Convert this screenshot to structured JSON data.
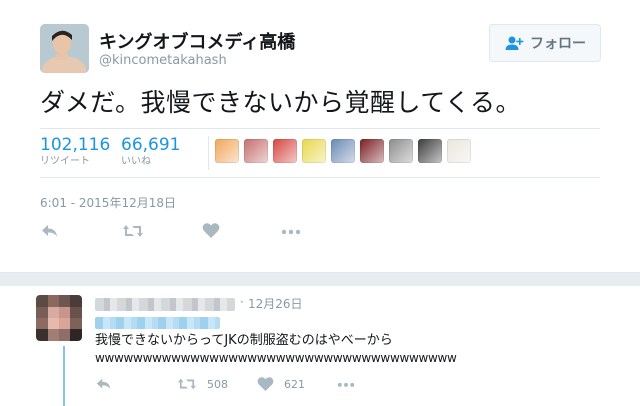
{
  "tweet": {
    "display_name": "キングオブコメディ高橋",
    "screen_name": "@kincometakahash",
    "text": "ダメだ。我慢できないから覚醒してくる。",
    "retweet_count": "102,116",
    "retweet_label": "リツイート",
    "like_count": "66,691",
    "like_label": "いいね",
    "timestamp": "6:01 - 2015年12月18日",
    "likers": [
      {
        "icon": "liker-avatar",
        "color": "#f2a65a"
      },
      {
        "icon": "liker-avatar",
        "color": "#c56e6e"
      },
      {
        "icon": "liker-avatar",
        "color": "#d64541"
      },
      {
        "icon": "liker-avatar",
        "color": "#e8d84a"
      },
      {
        "icon": "liker-avatar",
        "color": "#6a89b5"
      },
      {
        "icon": "liker-avatar",
        "color": "#7a1e22"
      },
      {
        "icon": "liker-avatar",
        "color": "#8c8c8c"
      },
      {
        "icon": "liker-avatar",
        "color": "#3b3b3b"
      },
      {
        "icon": "liker-avatar",
        "color": "#e9e6dc"
      }
    ]
  },
  "follow": {
    "label": "フォロー",
    "icon": "follow-person-plus-icon"
  },
  "actions": {
    "reply_icon": "reply-icon",
    "retweet_icon": "retweet-icon",
    "like_icon": "heart-icon",
    "more_icon": "more-icon"
  },
  "reply": {
    "dot": "·",
    "time": "12月26日",
    "text_line1": "我慢できないからってJKの制服盗むのはやべーから",
    "text_line2": "wwwwwwwwwwwwwwwwwwwwwwwwwwwwwwwwwwwwww",
    "retweet_count": "508",
    "like_count": "621"
  },
  "colors": {
    "accent": "#1b95e0",
    "muted": "#8899a6",
    "separator": "#e6ecf0",
    "thread": "#85c3f0"
  }
}
